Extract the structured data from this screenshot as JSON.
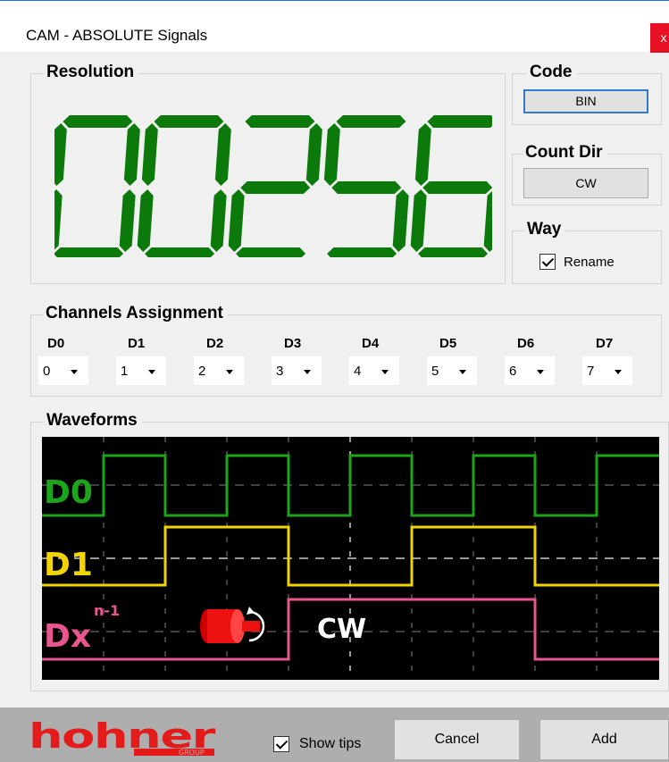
{
  "window": {
    "title": "CAM - ABSOLUTE Signals",
    "close_label": "x"
  },
  "resolution": {
    "legend": "Resolution",
    "value": "00256",
    "digit_color": "#0b7a0b"
  },
  "code": {
    "legend": "Code",
    "button": "BIN"
  },
  "count_dir": {
    "legend": "Count Dir",
    "button": "CW"
  },
  "way": {
    "legend": "Way",
    "rename_label": "Rename",
    "rename_checked": true
  },
  "channels": {
    "legend": "Channels Assignment",
    "items": [
      {
        "label": "D0",
        "value": "0"
      },
      {
        "label": "D1",
        "value": "1"
      },
      {
        "label": "D2",
        "value": "2"
      },
      {
        "label": "D3",
        "value": "3"
      },
      {
        "label": "D4",
        "value": "4"
      },
      {
        "label": "D5",
        "value": "5"
      },
      {
        "label": "D6",
        "value": "6"
      },
      {
        "label": "D7",
        "value": "7"
      }
    ]
  },
  "waveforms": {
    "legend": "Waveforms",
    "d0_label": "D0",
    "d1_label": "D1",
    "dx_label": "Dx",
    "dx_superscript": "n-1",
    "direction_label": "CW",
    "colors": {
      "d0": "#1aa51a",
      "d1": "#f2d500",
      "dx": "#e8558f",
      "grid": "#8a8a8a",
      "background": "#000000"
    }
  },
  "footer": {
    "logo_text": "hohner",
    "logo_subtext": "GROUP",
    "logo_color": "#e41b1b",
    "show_tips_label": "Show tips",
    "show_tips_checked": true,
    "cancel_label": "Cancel",
    "add_label": "Add"
  }
}
